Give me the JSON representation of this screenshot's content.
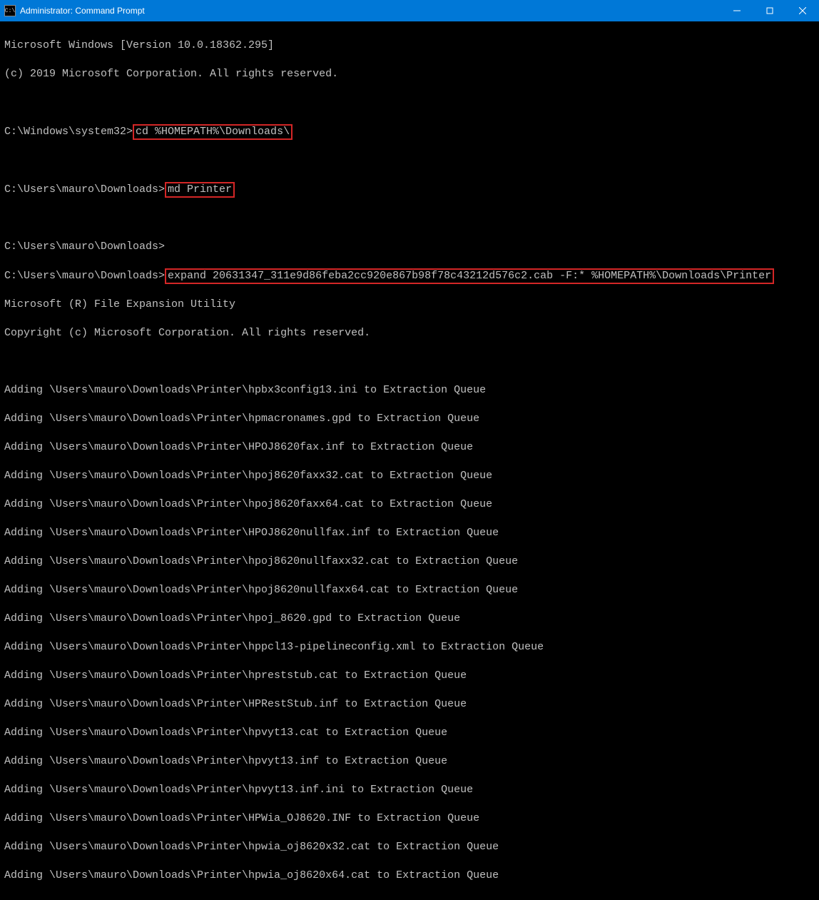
{
  "titlebar": {
    "icon_label": "C:\\",
    "title": "Administrator: Command Prompt"
  },
  "header": {
    "line1": "Microsoft Windows [Version 10.0.18362.295]",
    "line2": "(c) 2019 Microsoft Corporation. All rights reserved."
  },
  "prompts": {
    "p1_prefix": "C:\\Windows\\system32>",
    "p1_cmd": "cd %HOMEPATH%\\Downloads\\",
    "p2_prefix": "C:\\Users\\mauro\\Downloads>",
    "p2_cmd": "md Printer",
    "p3_prefix": "C:\\Users\\mauro\\Downloads>",
    "p4_prefix": "C:\\Users\\mauro\\Downloads>",
    "p4_cmd": "expand 20631347_311e9d86feba2cc920e867b98f78c43212d576c2.cab -F:* %HOMEPATH%\\Downloads\\Printer"
  },
  "expand_header": {
    "l1": "Microsoft (R) File Expansion Utility",
    "l2": "Copyright (c) Microsoft Corporation. All rights reserved."
  },
  "adding": [
    "Adding \\Users\\mauro\\Downloads\\Printer\\hpbx3config13.ini to Extraction Queue",
    "Adding \\Users\\mauro\\Downloads\\Printer\\hpmacronames.gpd to Extraction Queue",
    "Adding \\Users\\mauro\\Downloads\\Printer\\HPOJ8620fax.inf to Extraction Queue",
    "Adding \\Users\\mauro\\Downloads\\Printer\\hpoj8620faxx32.cat to Extraction Queue",
    "Adding \\Users\\mauro\\Downloads\\Printer\\hpoj8620faxx64.cat to Extraction Queue",
    "Adding \\Users\\mauro\\Downloads\\Printer\\HPOJ8620nullfax.inf to Extraction Queue",
    "Adding \\Users\\mauro\\Downloads\\Printer\\hpoj8620nullfaxx32.cat to Extraction Queue",
    "Adding \\Users\\mauro\\Downloads\\Printer\\hpoj8620nullfaxx64.cat to Extraction Queue",
    "Adding \\Users\\mauro\\Downloads\\Printer\\hpoj_8620.gpd to Extraction Queue",
    "Adding \\Users\\mauro\\Downloads\\Printer\\hppcl13-pipelineconfig.xml to Extraction Queue",
    "Adding \\Users\\mauro\\Downloads\\Printer\\hpreststub.cat to Extraction Queue",
    "Adding \\Users\\mauro\\Downloads\\Printer\\HPRestStub.inf to Extraction Queue",
    "Adding \\Users\\mauro\\Downloads\\Printer\\hpvyt13.cat to Extraction Queue",
    "Adding \\Users\\mauro\\Downloads\\Printer\\hpvyt13.inf to Extraction Queue",
    "Adding \\Users\\mauro\\Downloads\\Printer\\hpvyt13.inf.ini to Extraction Queue",
    "Adding \\Users\\mauro\\Downloads\\Printer\\HPWia_OJ8620.INF to Extraction Queue",
    "Adding \\Users\\mauro\\Downloads\\Printer\\hpwia_oj8620x32.cat to Extraction Queue",
    "Adding \\Users\\mauro\\Downloads\\Printer\\hpwia_oj8620x64.cat to Extraction Queue"
  ]
}
